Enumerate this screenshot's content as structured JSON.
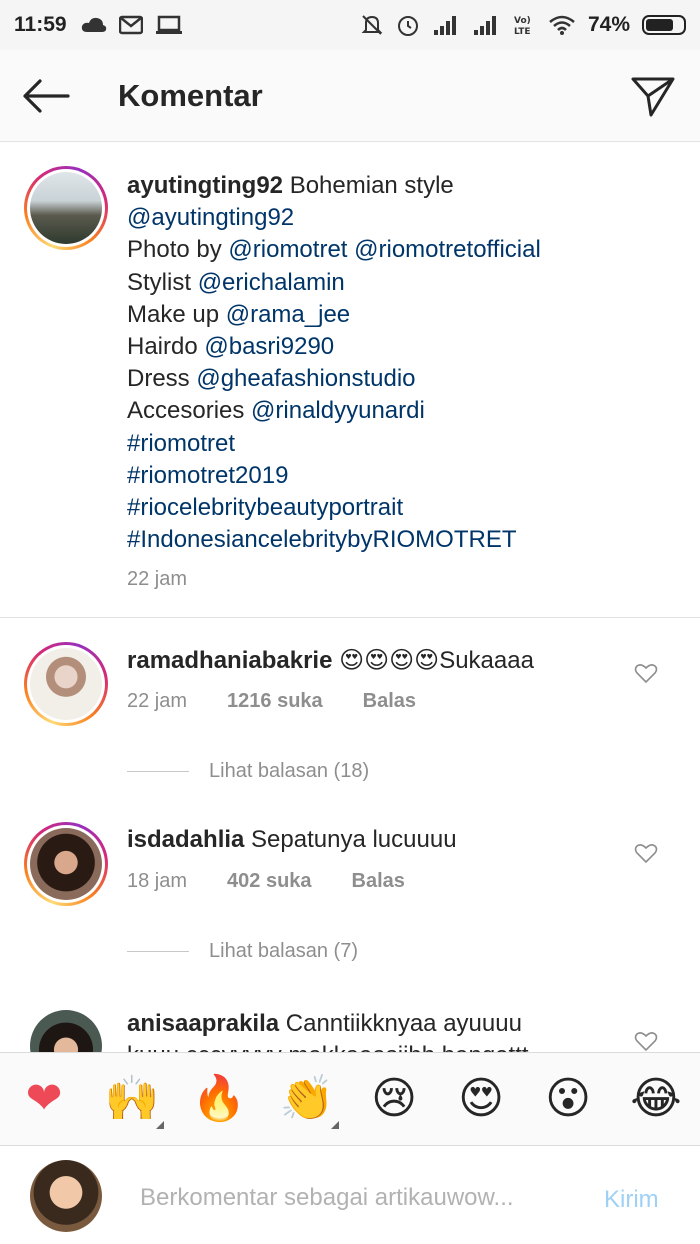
{
  "status_bar": {
    "time": "11:59",
    "battery": "74%",
    "battery_level": 0.74
  },
  "header": {
    "title": "Komentar",
    "back_icon": "arrow-left-icon",
    "send_icon": "paper-plane-icon"
  },
  "caption": {
    "username": "ayutingting92",
    "lines": [
      {
        "prefix": "",
        "text": "Bohemian style",
        "links": []
      },
      {
        "prefix": "",
        "text": "",
        "links": [
          "@ayutingting92"
        ]
      },
      {
        "prefix": "Photo by ",
        "links": [
          "@riomotret",
          "@riomotretofficial"
        ]
      },
      {
        "prefix": "Stylist ",
        "links": [
          "@erichalamin"
        ]
      },
      {
        "prefix": "Make up ",
        "links": [
          "@rama_jee"
        ]
      },
      {
        "prefix": "Hairdo ",
        "links": [
          "@basri9290"
        ]
      },
      {
        "prefix": "Dress ",
        "links": [
          "@gheafashionstudio"
        ]
      },
      {
        "prefix": "Accesories ",
        "links": [
          "@rinaldyyunardi"
        ]
      },
      {
        "prefix": "",
        "links": [
          "#riomotret"
        ]
      },
      {
        "prefix": "",
        "links": [
          "#riomotret2019"
        ]
      },
      {
        "prefix": "",
        "links": [
          "#riocelebritybeautyportrait"
        ]
      },
      {
        "prefix": "",
        "links": [
          "#IndonesiancelebritybyRIOMOTRET"
        ]
      }
    ],
    "time": "22 jam"
  },
  "comments": [
    {
      "username": "ramadhaniabakrie",
      "text": "😍😍😍😍Sukaaaa",
      "time": "22 jam",
      "likes": "1216 suka",
      "reply": "Balas",
      "view_replies": "Lihat balasan (18)"
    },
    {
      "username": "isdadahlia",
      "text": "Sepatunya lucuuuu",
      "time": "18 jam",
      "likes": "402 suka",
      "reply": "Balas",
      "view_replies": "Lihat balasan (7)"
    },
    {
      "username": "anisaaprakila",
      "text": "Canntiikknyaa ayuuuu",
      "text_line2": "kuuu cccvvvvv  makkaaasiihh bangettt"
    }
  ],
  "emoji_bar": [
    "❤",
    "🙌",
    "🔥",
    "👏",
    "😢",
    "😍",
    "😮",
    "😂"
  ],
  "input": {
    "placeholder": "Berkomentar sebagai artikauwow...",
    "send_label": "Kirim"
  },
  "colors": {
    "link": "#003569",
    "muted": "#8e8e8e",
    "heart": "#ed4956",
    "send_disabled": "#9fd0f5"
  }
}
